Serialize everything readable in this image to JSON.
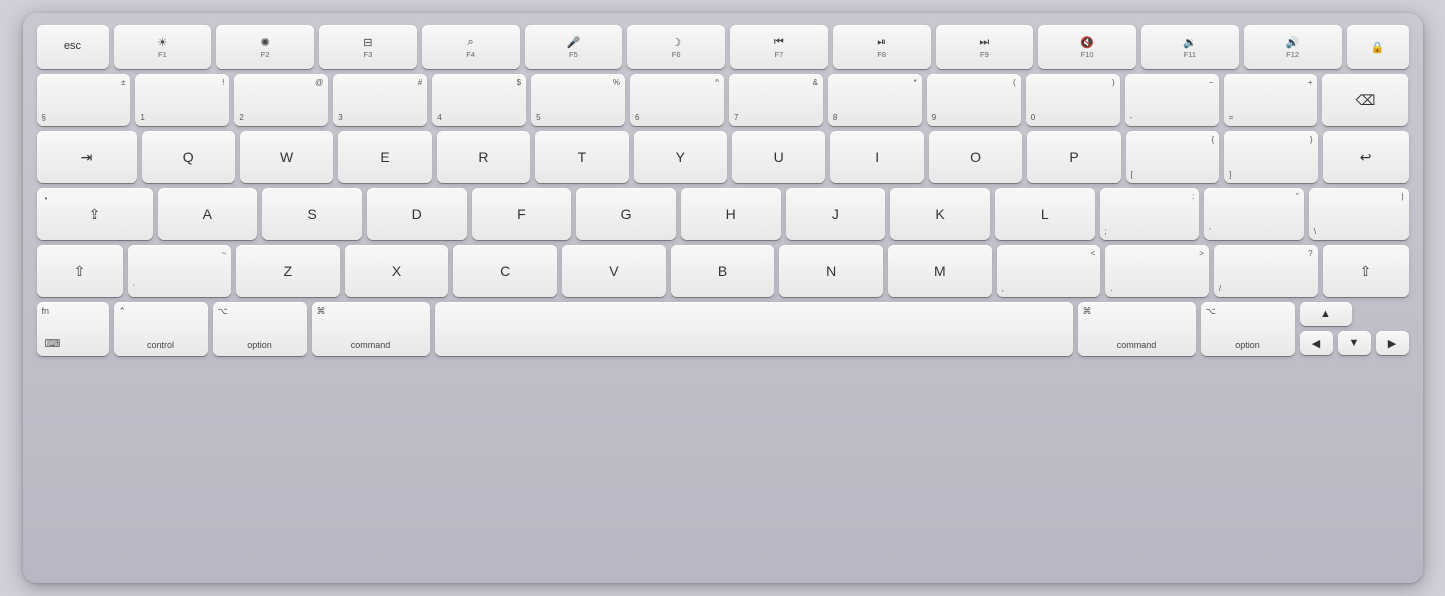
{
  "keyboard": {
    "rows": {
      "fn_row": {
        "keys": [
          {
            "id": "esc",
            "label": "esc",
            "width": "esc"
          },
          {
            "id": "f1",
            "label": "F1",
            "icon": "☀",
            "sub": "F1"
          },
          {
            "id": "f2",
            "label": "F2",
            "icon": "☼",
            "sub": "F2"
          },
          {
            "id": "f3",
            "label": "F3",
            "icon": "⊞",
            "sub": "F3"
          },
          {
            "id": "f4",
            "label": "F4",
            "icon": "⌕",
            "sub": "F4"
          },
          {
            "id": "f5",
            "label": "F5",
            "icon": "🎤",
            "sub": "F5"
          },
          {
            "id": "f6",
            "label": "F6",
            "icon": "☽",
            "sub": "F6"
          },
          {
            "id": "f7",
            "label": "F7",
            "icon": "⏮",
            "sub": "F7"
          },
          {
            "id": "f8",
            "label": "F8",
            "icon": "⏯",
            "sub": "F8"
          },
          {
            "id": "f9",
            "label": "F9",
            "icon": "⏭",
            "sub": "F9"
          },
          {
            "id": "f10",
            "label": "F10",
            "icon": "🔇",
            "sub": "F10"
          },
          {
            "id": "f11",
            "label": "F11",
            "icon": "🔉",
            "sub": "F11"
          },
          {
            "id": "f12",
            "label": "F12",
            "icon": "🔊",
            "sub": "F12"
          },
          {
            "id": "lock",
            "label": "🔒",
            "width": "lock"
          }
        ]
      },
      "number_row": {
        "keys": [
          {
            "id": "sect",
            "top": "±",
            "bottom": "§"
          },
          {
            "id": "1",
            "top": "!",
            "bottom": "1"
          },
          {
            "id": "2",
            "top": "@",
            "bottom": "2"
          },
          {
            "id": "3",
            "top": "#",
            "bottom": "3"
          },
          {
            "id": "4",
            "top": "$",
            "bottom": "4"
          },
          {
            "id": "5",
            "top": "%",
            "bottom": "5"
          },
          {
            "id": "6",
            "top": "^",
            "bottom": "6"
          },
          {
            "id": "7",
            "top": "&",
            "bottom": "7"
          },
          {
            "id": "8",
            "top": "*",
            "bottom": "8"
          },
          {
            "id": "9",
            "top": "(",
            "bottom": "9"
          },
          {
            "id": "0",
            "top": ")",
            "bottom": "0"
          },
          {
            "id": "minus",
            "top": "−",
            "bottom": "-"
          },
          {
            "id": "equals",
            "top": "+",
            "bottom": "="
          },
          {
            "id": "backspace",
            "label": "⌫",
            "width": "backspace"
          }
        ]
      },
      "qwerty_row": {
        "keys": [
          {
            "id": "tab",
            "label": "⇥",
            "width": "tab"
          },
          {
            "id": "q",
            "label": "Q"
          },
          {
            "id": "w",
            "label": "W"
          },
          {
            "id": "e",
            "label": "E"
          },
          {
            "id": "r",
            "label": "R"
          },
          {
            "id": "t",
            "label": "T"
          },
          {
            "id": "y",
            "label": "Y"
          },
          {
            "id": "u",
            "label": "U"
          },
          {
            "id": "i",
            "label": "I"
          },
          {
            "id": "o",
            "label": "O"
          },
          {
            "id": "p",
            "label": "P"
          },
          {
            "id": "open-bracket",
            "top": "{",
            "bottom": "["
          },
          {
            "id": "close-bracket",
            "top": "}",
            "bottom": "]"
          },
          {
            "id": "return",
            "label": "↩",
            "width": "return"
          }
        ]
      },
      "asdf_row": {
        "keys": [
          {
            "id": "caps",
            "top": "•",
            "label": "⇪",
            "width": "caps"
          },
          {
            "id": "a",
            "label": "A"
          },
          {
            "id": "s",
            "label": "S"
          },
          {
            "id": "d",
            "label": "D"
          },
          {
            "id": "f",
            "label": "F"
          },
          {
            "id": "g",
            "label": "G"
          },
          {
            "id": "h",
            "label": "H"
          },
          {
            "id": "j",
            "label": "J"
          },
          {
            "id": "k",
            "label": "K"
          },
          {
            "id": "l",
            "label": "L"
          },
          {
            "id": "semicolon",
            "top": ":",
            "bottom": ";"
          },
          {
            "id": "quote",
            "top": "\"",
            "bottom": "'"
          },
          {
            "id": "backslash",
            "top": "|",
            "bottom": "\\"
          }
        ]
      },
      "zxcv_row": {
        "keys": [
          {
            "id": "shift-l",
            "label": "⇧",
            "width": "shift-l"
          },
          {
            "id": "backtick",
            "top": "~",
            "bottom": "`"
          },
          {
            "id": "z",
            "label": "Z"
          },
          {
            "id": "x",
            "label": "X"
          },
          {
            "id": "c",
            "label": "C"
          },
          {
            "id": "v",
            "label": "V"
          },
          {
            "id": "b",
            "label": "B"
          },
          {
            "id": "n",
            "label": "N"
          },
          {
            "id": "m",
            "label": "M"
          },
          {
            "id": "comma",
            "top": "<",
            "bottom": ","
          },
          {
            "id": "period",
            "top": ">",
            "bottom": "."
          },
          {
            "id": "slash",
            "top": "?",
            "bottom": "/"
          },
          {
            "id": "shift-r",
            "label": "⇧",
            "width": "shift-r"
          }
        ]
      },
      "bottom_row": {
        "keys": [
          {
            "id": "fn",
            "top": "fn",
            "bottom": "⌨",
            "width": "fn-key"
          },
          {
            "id": "control",
            "top": "⌃",
            "bottom": "control",
            "width": "control"
          },
          {
            "id": "option-l",
            "top": "⌥",
            "bottom": "option",
            "width": "option"
          },
          {
            "id": "command-l",
            "top": "⌘",
            "bottom": "command",
            "width": "command-l"
          },
          {
            "id": "space",
            "label": "",
            "width": "space"
          },
          {
            "id": "command-r",
            "top": "⌘",
            "bottom": "command",
            "width": "command-r"
          },
          {
            "id": "option-r",
            "top": "⌥",
            "bottom": "option",
            "width": "option-r"
          }
        ]
      }
    }
  }
}
